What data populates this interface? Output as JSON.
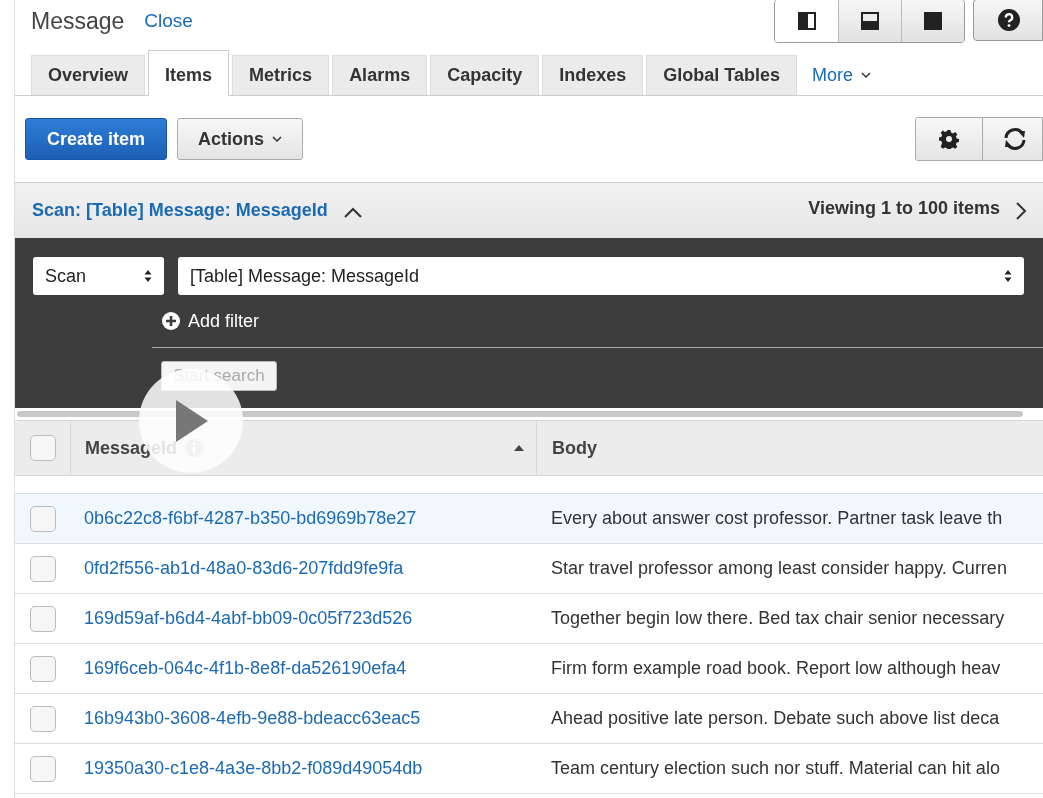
{
  "header": {
    "title": "Message",
    "close": "Close",
    "layouts": [
      {
        "kind": "split-left",
        "selected": true
      },
      {
        "kind": "split-bottom",
        "selected": false
      },
      {
        "kind": "full",
        "selected": false
      }
    ]
  },
  "tabs": [
    {
      "label": "Overview",
      "selected": false
    },
    {
      "label": "Items",
      "selected": true
    },
    {
      "label": "Metrics",
      "selected": false
    },
    {
      "label": "Alarms",
      "selected": false
    },
    {
      "label": "Capacity",
      "selected": false
    },
    {
      "label": "Indexes",
      "selected": false
    },
    {
      "label": "Global Tables",
      "selected": false
    }
  ],
  "more": "More",
  "toolbar": {
    "create": "Create item",
    "actions": "Actions"
  },
  "scan_bar": {
    "title": "Scan: [Table] Message: MessageId",
    "expanded": true,
    "viewing": "Viewing 1 to 100 items"
  },
  "query": {
    "mode": "Scan",
    "target": "[Table] Message: MessageId",
    "add_filter": "Add filter",
    "start": "Start search"
  },
  "table": {
    "select_all": {
      "checked": false
    },
    "columns": [
      "MessageId",
      "Body"
    ],
    "rows": [
      {
        "id": "0b6c22c8-f6bf-4287-b350-bd6969b78e27",
        "body": "Every about answer cost professor. Partner task leave th",
        "selected": true
      },
      {
        "id": "0fd2f556-ab1d-48a0-83d6-207fdd9fe9fa",
        "body": "Star travel professor among least consider happy. Curren",
        "selected": false
      },
      {
        "id": "169d59af-b6d4-4abf-bb09-0c05f723d526",
        "body": "Together begin low there. Bed tax chair senior necessary",
        "selected": false
      },
      {
        "id": "169f6ceb-064c-4f1b-8e8f-da526190efa4",
        "body": "Firm form example road book. Report low although heav",
        "selected": false
      },
      {
        "id": "16b943b0-3608-4efb-9e88-bdeacc63eac5",
        "body": "Ahead positive late person. Debate such above list deca",
        "selected": false
      },
      {
        "id": "19350a30-c1e8-4a3e-8bb2-f089d49054db",
        "body": "Team century election such nor stuff. Material can hit alo",
        "selected": false
      }
    ]
  }
}
